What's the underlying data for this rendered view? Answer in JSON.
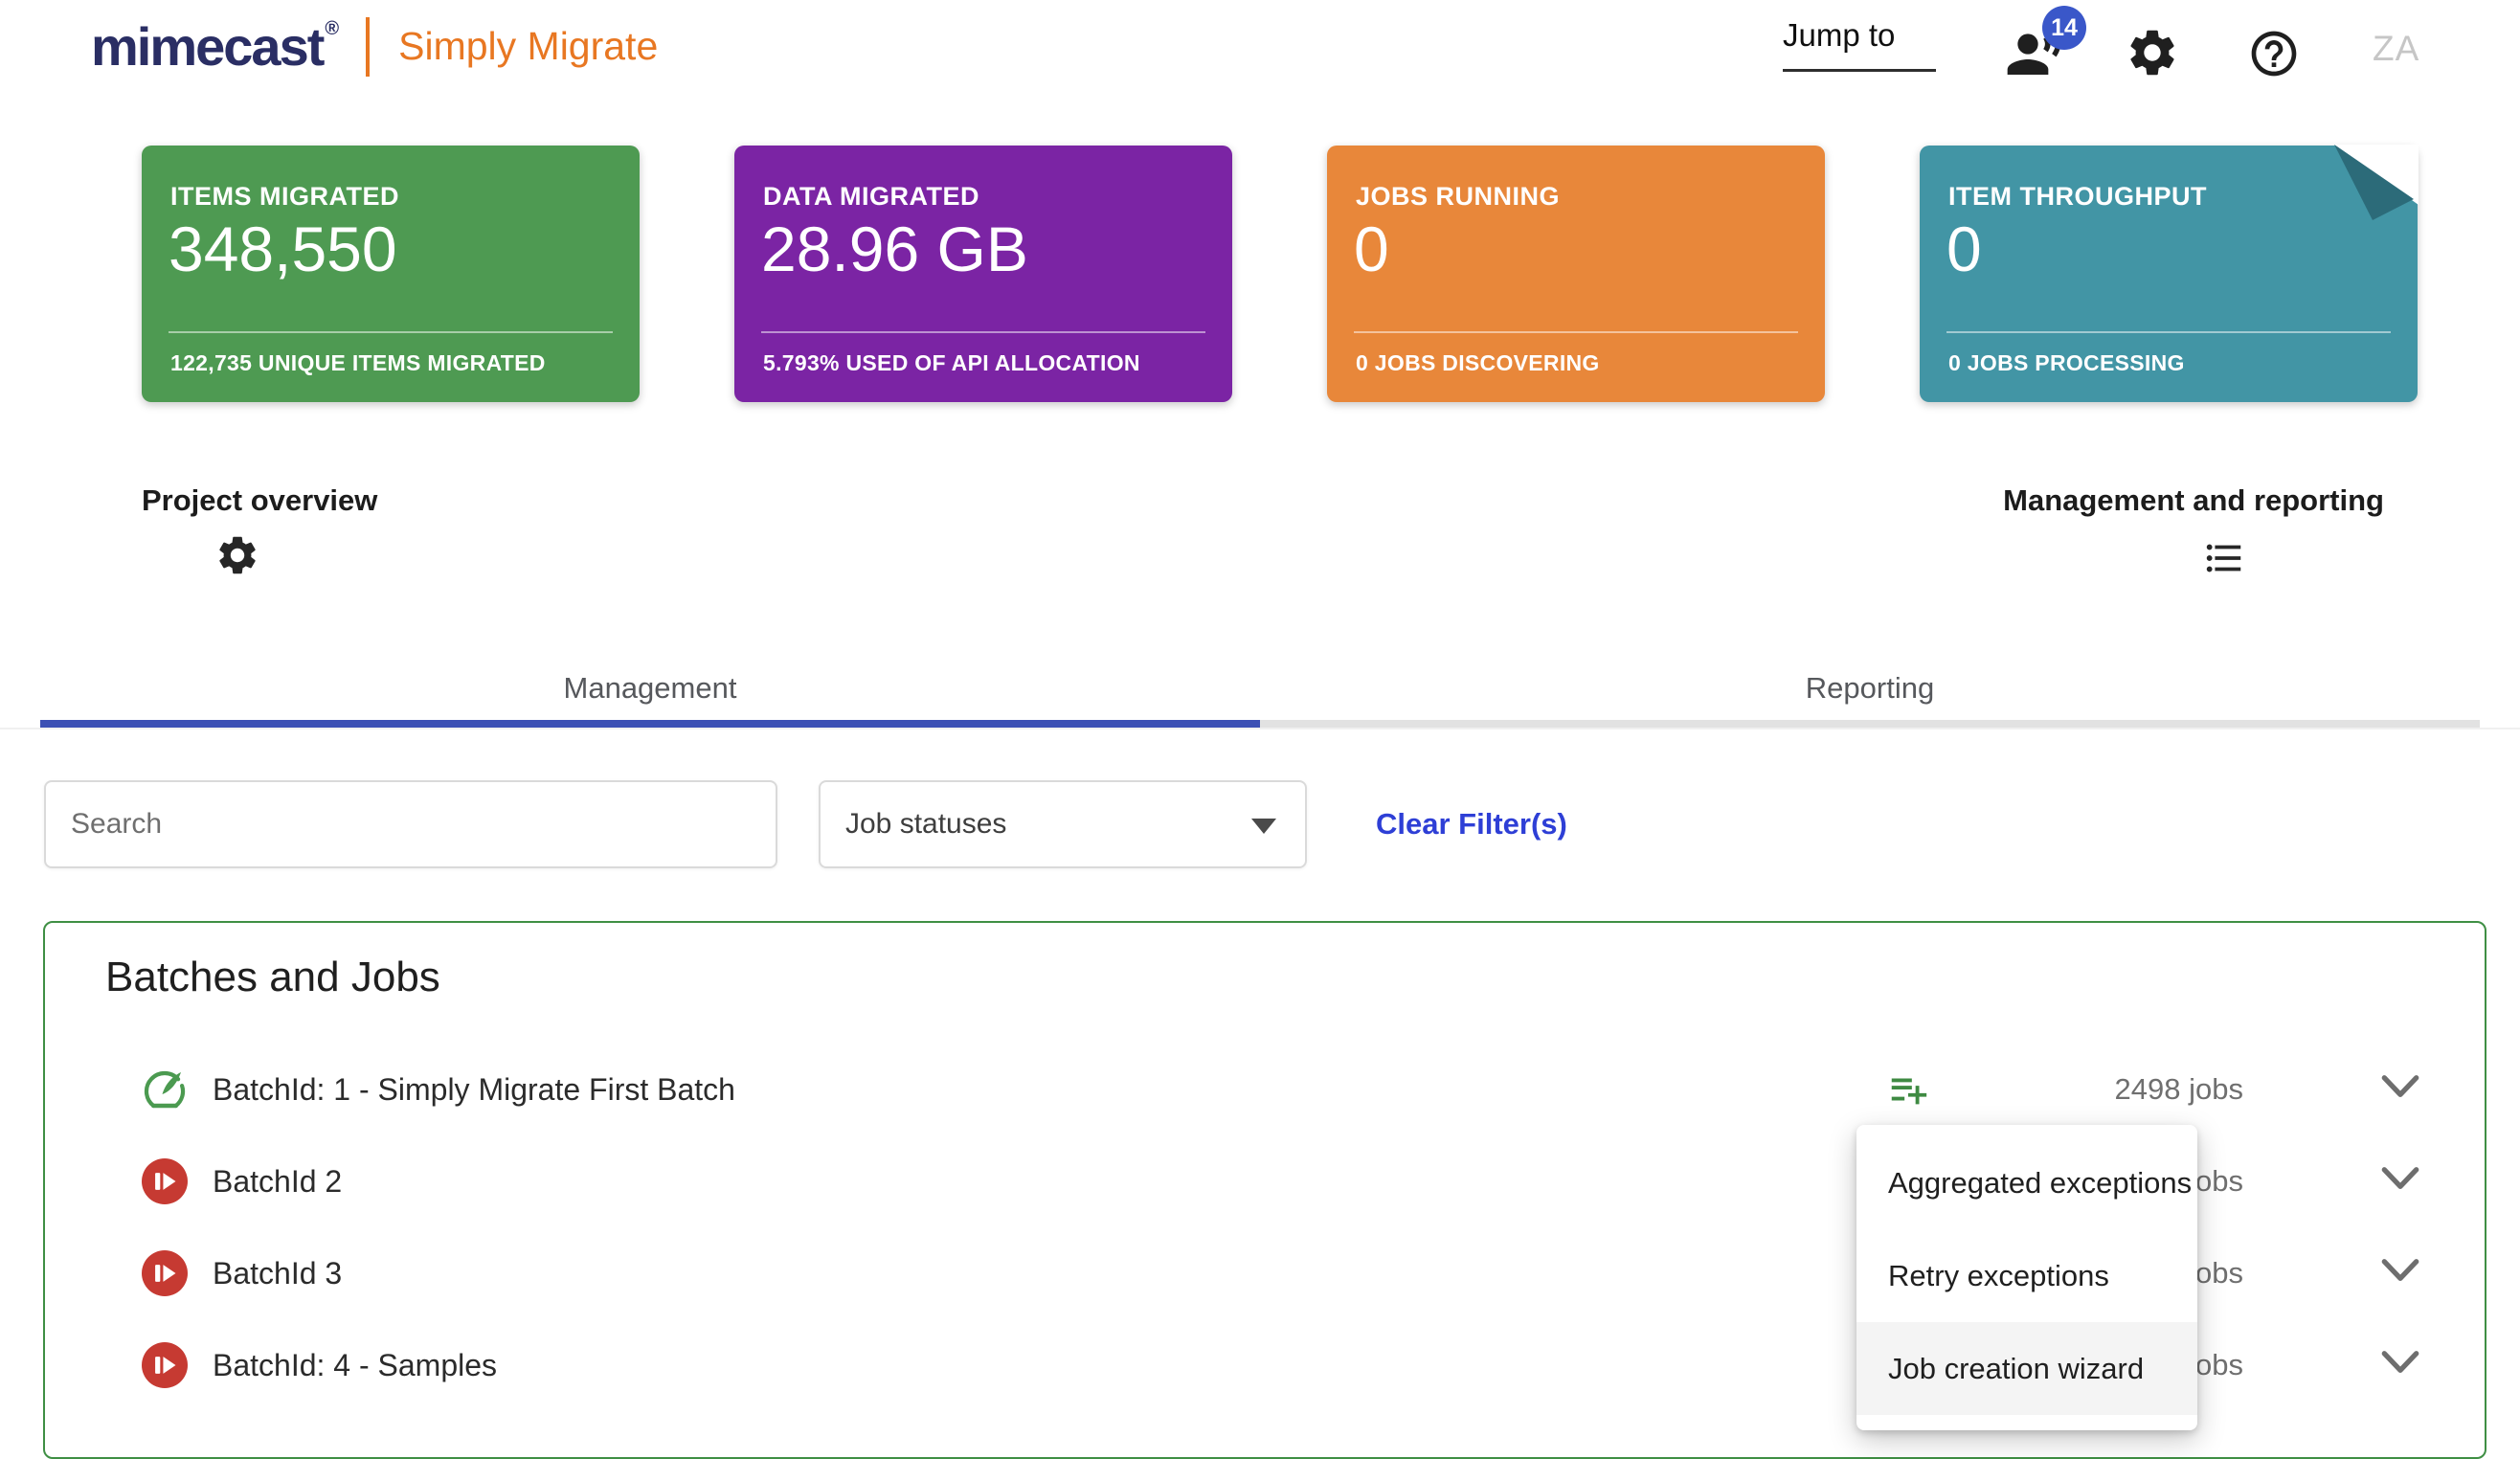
{
  "header": {
    "brand": "mimecast",
    "brand_reg": "®",
    "product": "Simply Migrate",
    "jump_to_label": "Jump to",
    "notifications_count": "14",
    "avatar_initials": "ZA"
  },
  "cards": [
    {
      "title": "ITEMS MIGRATED",
      "value": "348,550",
      "caption": "122,735 UNIQUE ITEMS MIGRATED",
      "color": "#4e9a52"
    },
    {
      "title": "DATA MIGRATED",
      "value": "28.96 GB",
      "caption": "5.793% USED OF API ALLOCATION",
      "color": "#7b24a4"
    },
    {
      "title": "JOBS RUNNING",
      "value": "0",
      "caption": "0 JOBS DISCOVERING",
      "color": "#e8873a"
    },
    {
      "title": "ITEM THROUGHPUT",
      "value": "0",
      "caption": "0 JOBS PROCESSING",
      "color": "#4295a5"
    }
  ],
  "sections": {
    "left_label": "Project overview",
    "right_label": "Management and reporting"
  },
  "tabs": [
    {
      "label": "Management",
      "active": true
    },
    {
      "label": "Reporting",
      "active": false
    }
  ],
  "filters": {
    "search_placeholder": "Search",
    "job_statuses_label": "Job statuses",
    "clear_label": "Clear Filter(s)"
  },
  "batches": {
    "title": "Batches and Jobs",
    "rows": [
      {
        "label": "BatchId: 1 - Simply Migrate First Batch",
        "status": "running-ok",
        "jobs": "2498 jobs"
      },
      {
        "label": "BatchId 2",
        "status": "paused",
        "jobs": "jobs"
      },
      {
        "label": "BatchId 3",
        "status": "paused",
        "jobs": "jobs"
      },
      {
        "label": "BatchId: 4 - Samples",
        "status": "paused",
        "jobs": "jobs"
      }
    ]
  },
  "menu": {
    "items": [
      {
        "label": "Aggregated exceptions",
        "highlighted": false
      },
      {
        "label": "Retry exceptions",
        "highlighted": false
      },
      {
        "label": "Job creation wizard",
        "highlighted": true
      }
    ]
  },
  "colors": {
    "brand_navy": "#2a2e64",
    "brand_orange": "#e87722",
    "card_green": "#4e9a52",
    "card_purple": "#7b24a4",
    "card_orange": "#e8873a",
    "card_teal": "#4295a5",
    "teal_fold": "#2c6b79",
    "tab_active_ink": "#3c50b4",
    "badge_blue": "#3a57c9",
    "link_blue": "#2e3fd6",
    "panel_border_green": "#3f8f44",
    "status_red": "#c63a32"
  }
}
